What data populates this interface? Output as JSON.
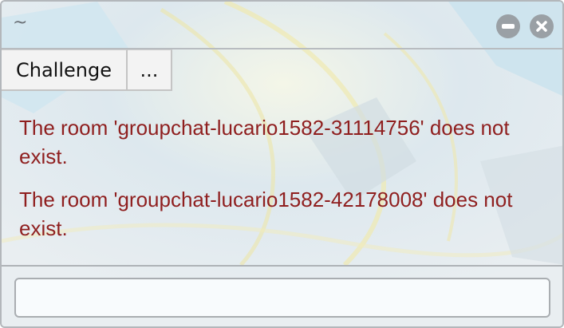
{
  "window": {
    "title": "~"
  },
  "tabs": [
    {
      "label": "Challenge"
    },
    {
      "label": "..."
    }
  ],
  "messages": [
    "The room 'groupchat-lucario1582-31114756' does not exist.",
    "The room 'groupchat-lucario1582-42178008' does not exist."
  ],
  "chat_input": {
    "value": "",
    "placeholder": ""
  },
  "colors": {
    "error_text": "#8f1f1f",
    "window_button": "#9aa0a5"
  }
}
